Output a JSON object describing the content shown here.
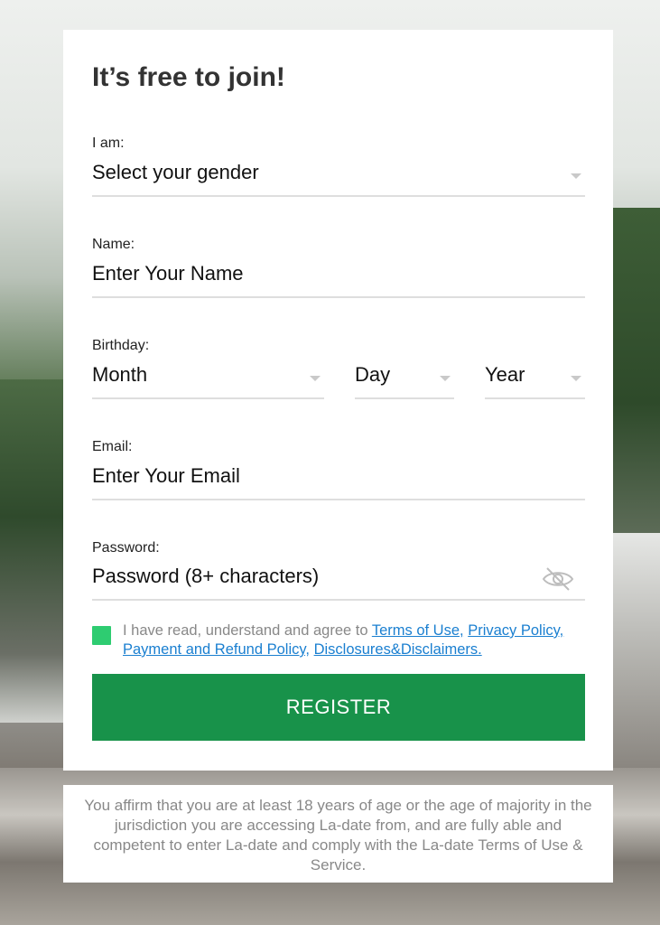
{
  "form": {
    "title": "It’s free to join!",
    "gender": {
      "label": "I am:",
      "placeholder": "Select your gender"
    },
    "name": {
      "label": "Name:",
      "placeholder": "Enter Your Name"
    },
    "birthday": {
      "label": "Birthday:",
      "month_placeholder": "Month",
      "day_placeholder": "Day",
      "year_placeholder": "Year"
    },
    "email": {
      "label": "Email:",
      "placeholder": "Enter Your Email"
    },
    "password": {
      "label": "Password:",
      "placeholder": "Password (8+ characters)",
      "toggle_icon": "eye-slash-icon"
    },
    "agreement": {
      "checked": true,
      "text": "I have read, understand and agree to ",
      "links": [
        "Terms of Use,",
        "Privacy Policy,",
        "Payment and Refund Policy,",
        "Disclosures&Disclaimers."
      ]
    },
    "register_label": "REGISTER"
  },
  "disclaimer": "You affirm that you are at least 18 years of age or the age of majority in the jurisdiction you are accessing La-date from, and are fully able and competent to enter La-date and comply with the La-date Terms of Use & Service.",
  "colors": {
    "accent": "#18924a",
    "checkbox": "#2ecc71",
    "link": "#1a7fd0"
  }
}
